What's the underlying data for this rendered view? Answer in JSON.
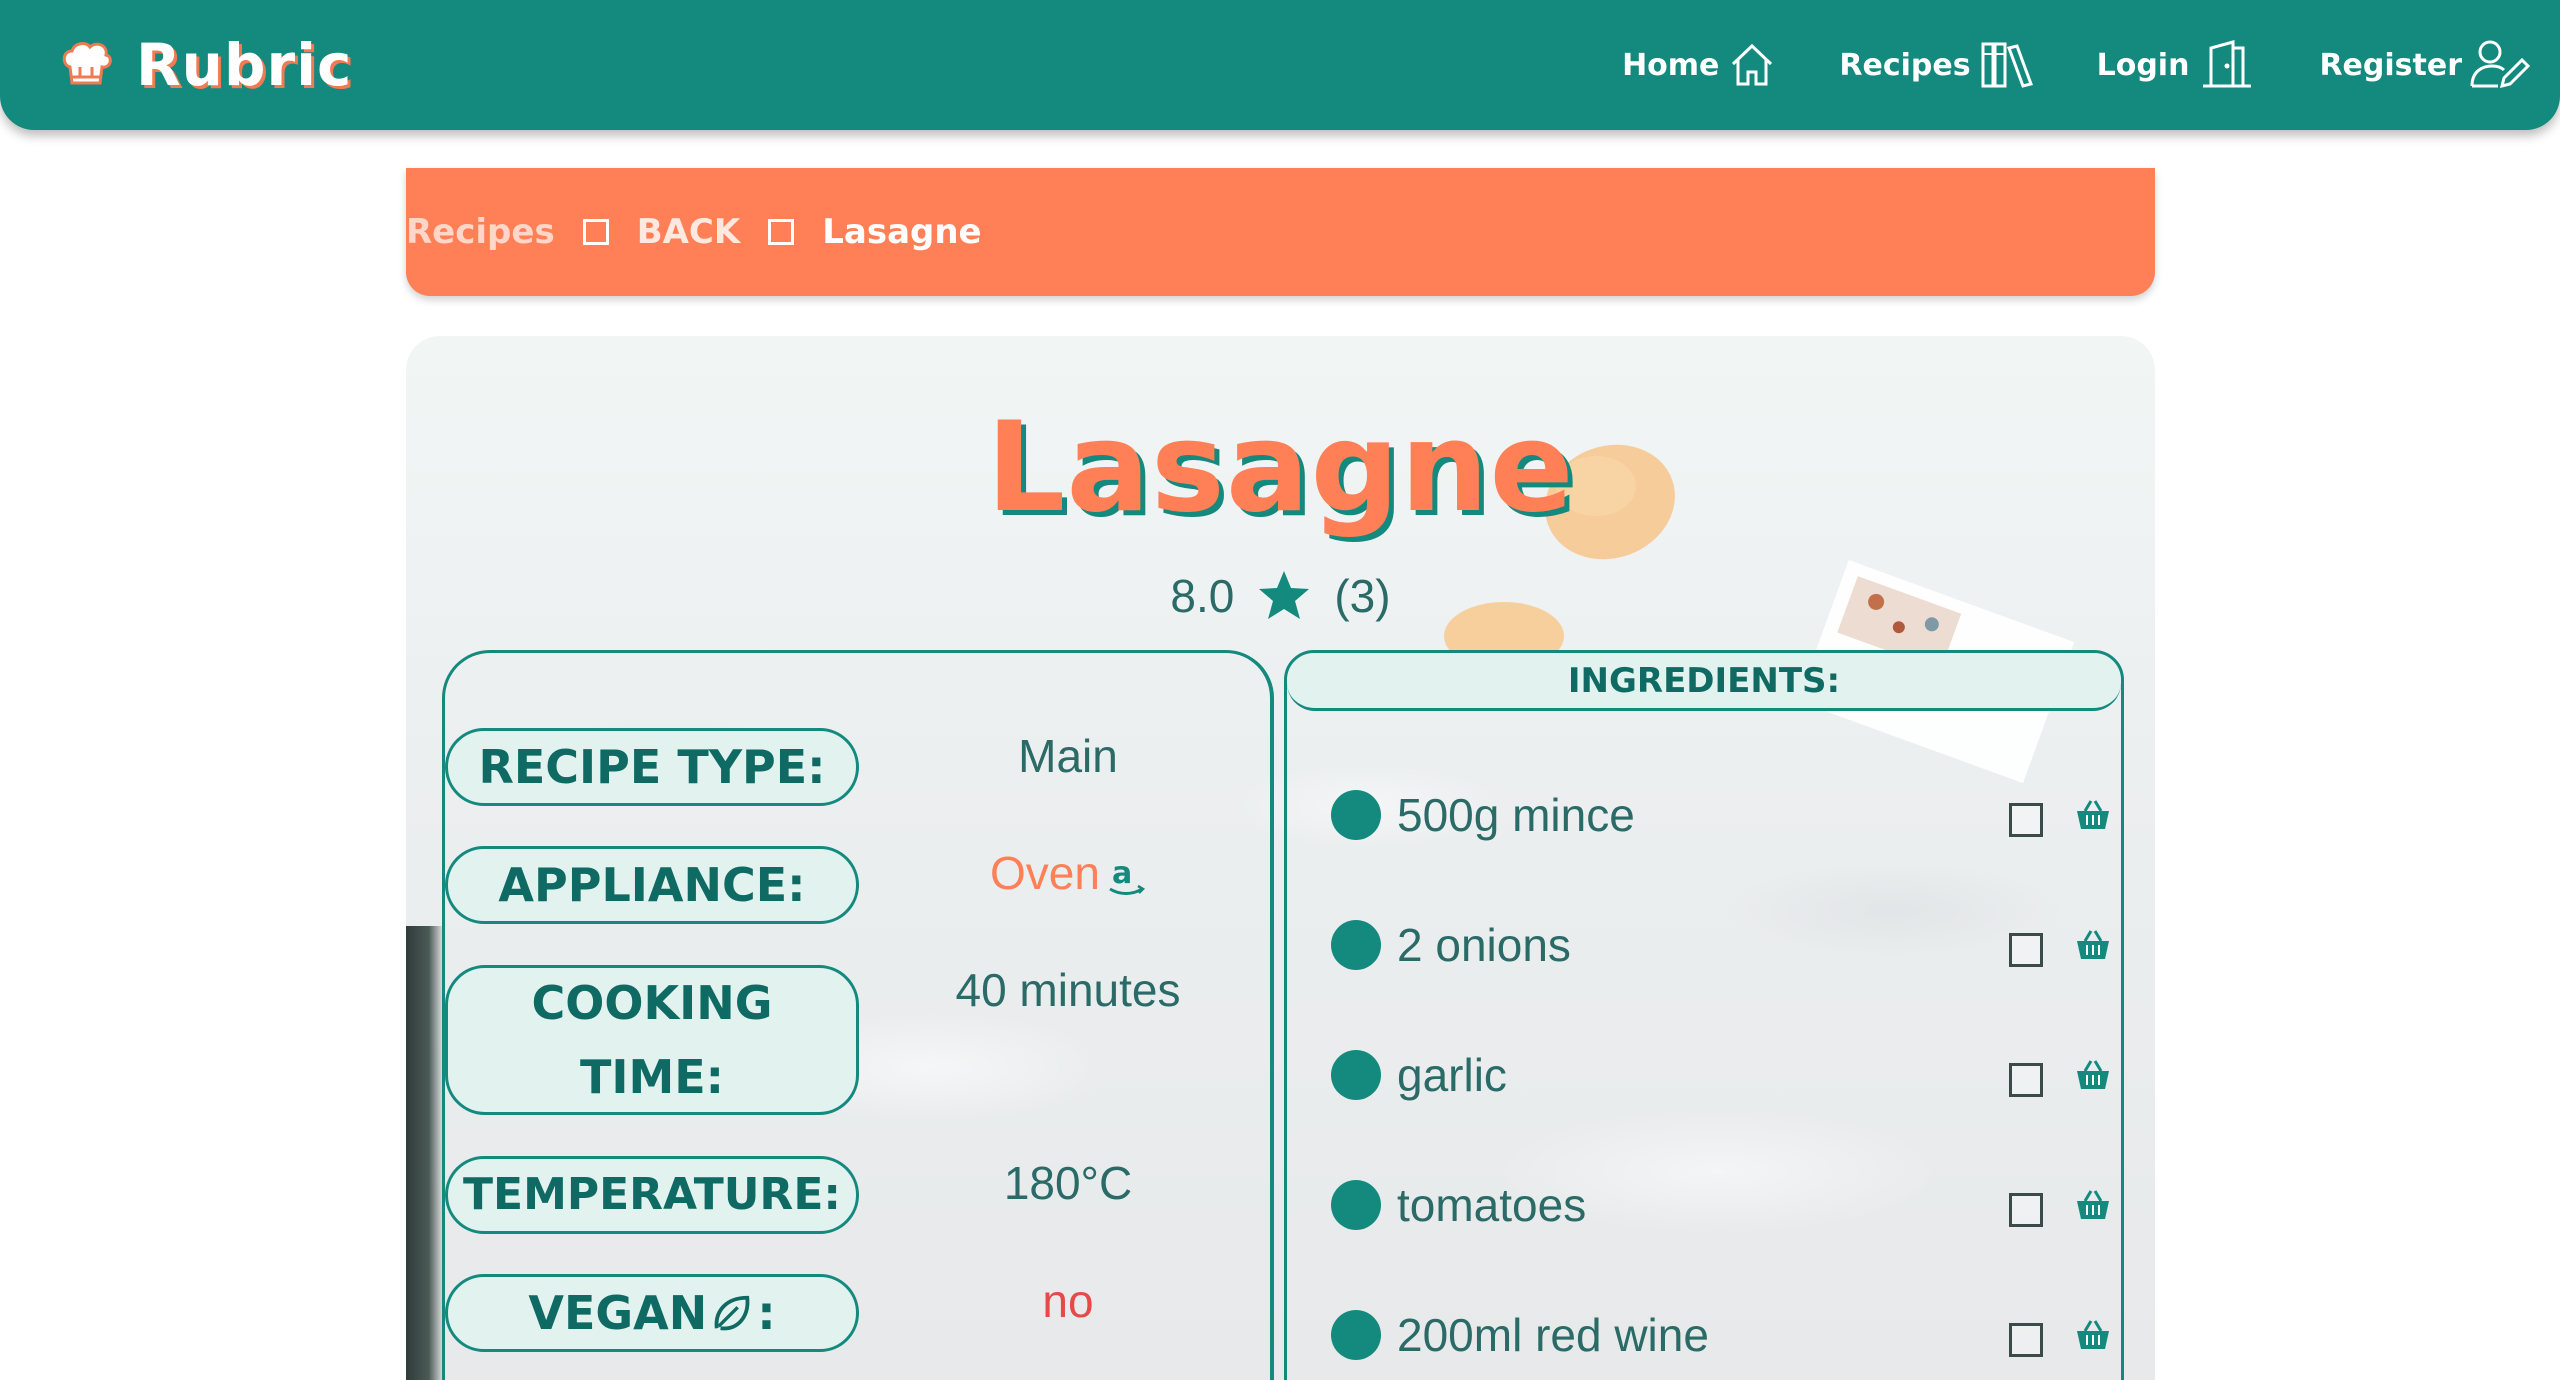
{
  "header": {
    "brand": "Rubric",
    "nav": [
      {
        "label": "Home",
        "icon": "home-icon"
      },
      {
        "label": "Recipes",
        "icon": "books-icon"
      },
      {
        "label": "Login",
        "icon": "door-icon"
      },
      {
        "label": "Register",
        "icon": "user-edit-icon"
      }
    ]
  },
  "breadcrumb": {
    "items": [
      "Recipes",
      "BACK",
      "Lasagne"
    ]
  },
  "recipe": {
    "title": "Lasagne",
    "rating": "8.0",
    "rating_count": "(3)",
    "details": [
      {
        "label": "RECIPE TYPE:",
        "value": "Main"
      },
      {
        "label": "APPLIANCE:",
        "value": "Oven"
      },
      {
        "label": "COOKING TIME:",
        "value": "40 minutes"
      },
      {
        "label": "TEMPERATURE:",
        "value": "180°C"
      },
      {
        "label": "VEGAN",
        "label_suffix": ":",
        "value": "no"
      }
    ],
    "ingredients_title": "INGREDIENTS:",
    "ingredients": [
      "500g mince",
      "2 onions",
      "garlic",
      "tomatoes",
      "200ml red wine"
    ]
  },
  "colors": {
    "teal": "#14897d",
    "orange": "#ff7f56",
    "light_teal": "#e1f2ef"
  }
}
